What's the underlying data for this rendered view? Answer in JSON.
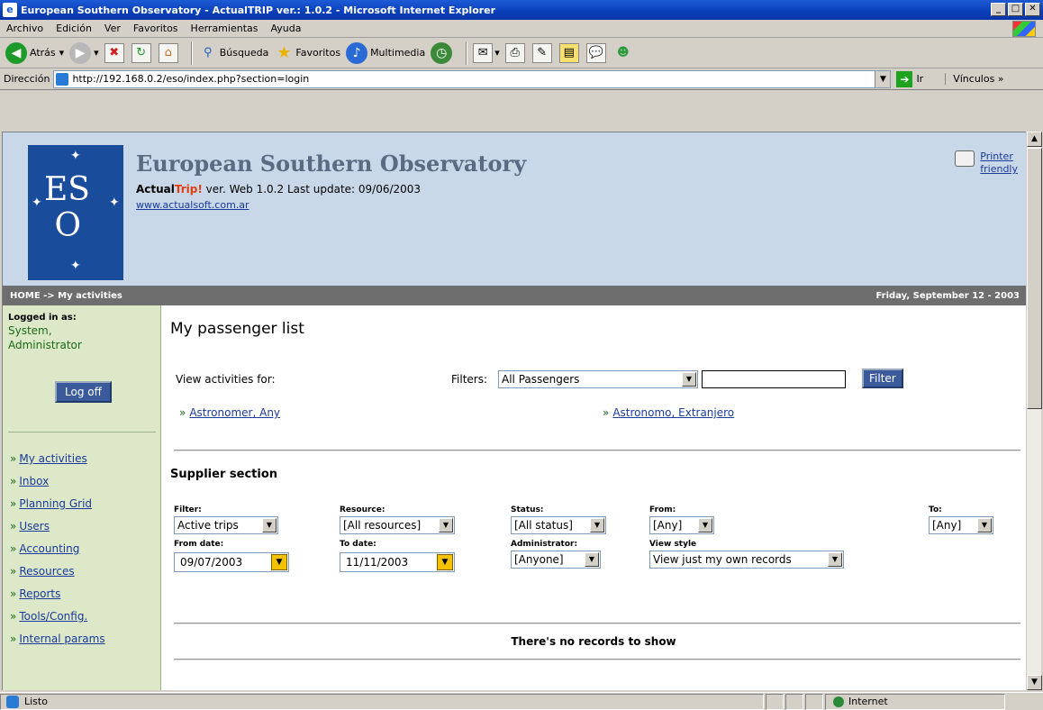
{
  "window": {
    "title": "European Southern Observatory - ActualTRIP ver.: 1.0.2 - Microsoft Internet Explorer"
  },
  "menu": [
    "Archivo",
    "Edición",
    "Ver",
    "Favoritos",
    "Herramientas",
    "Ayuda"
  ],
  "toolbar": {
    "back": "Atrás",
    "search": "Búsqueda",
    "favorites": "Favoritos",
    "media": "Multimedia"
  },
  "address": {
    "label": "Dirección",
    "url": "http://192.168.0.2/eso/index.php?section=login",
    "go": "Ir",
    "links": "Vínculos"
  },
  "header": {
    "org": "European Southern Observatory",
    "brand_actual": "Actual",
    "brand_trip": "Trip!",
    "version": " ver. Web 1.0.2 Last update: 09/06/2003",
    "site": "www.actualsoft.com.ar",
    "printer": [
      "Printer",
      "friendly"
    ]
  },
  "crumb": {
    "path": "HOME -> My activities",
    "date": "Friday, September 12 - 2003"
  },
  "sidebar": {
    "logged_label": "Logged in as:",
    "user_line1": "System,",
    "user_line2": "Administrator",
    "logoff": "Log off",
    "nav": [
      "My activities",
      "Inbox",
      "Planning Grid",
      "Users",
      "Accounting",
      "Resources",
      "Reports",
      "Tools/Config.",
      "Internal params"
    ]
  },
  "main": {
    "title": "My passenger list",
    "view_for": "View activities for:",
    "filters_label": "Filters:",
    "filter_value": "All Passengers",
    "filter_text": "",
    "filter_button": "Filter",
    "passengers": [
      "Astronomer, Any",
      "Astronomo, Extranjero"
    ],
    "supplier_title": "Supplier section",
    "fields": {
      "filter_label": "Filter:",
      "filter_value": "Active trips",
      "resource_label": "Resource:",
      "resource_value": "[All resources]",
      "status_label": "Status:",
      "status_value": "[All status]",
      "from_label": "From:",
      "from_value": "[Any]",
      "to_label": "To:",
      "to_value": "[Any]",
      "from_date_label": "From date:",
      "from_date": "09/07/2003",
      "to_date_label": "To date:",
      "to_date": "11/11/2003",
      "admin_label": "Administrator:",
      "admin_value": "[Anyone]",
      "view_style_label": "View style",
      "view_style_value": "View just my own records"
    },
    "no_records": "There's no records to show"
  },
  "status": {
    "text": "Listo",
    "zone": "Internet"
  },
  "icons": {
    "back": "back-arrow-icon",
    "forward": "forward-arrow-icon",
    "stop": "stop-icon",
    "refresh": "refresh-icon",
    "home": "home-icon",
    "search": "search-icon",
    "favorites": "star-icon",
    "media": "media-icon",
    "history": "history-icon",
    "mail": "mail-icon",
    "print": "print-icon",
    "edit": "edit-icon",
    "messenger": "messenger-icon"
  },
  "colors": {
    "header_bg": "#c8d8e8",
    "logo_bg": "#1a4c9c",
    "sidebar_bg": "#dce8c8",
    "crumb_bg": "#6e6e6e",
    "button_bg": "#3a5a9c",
    "link": "#1a3a9c"
  }
}
